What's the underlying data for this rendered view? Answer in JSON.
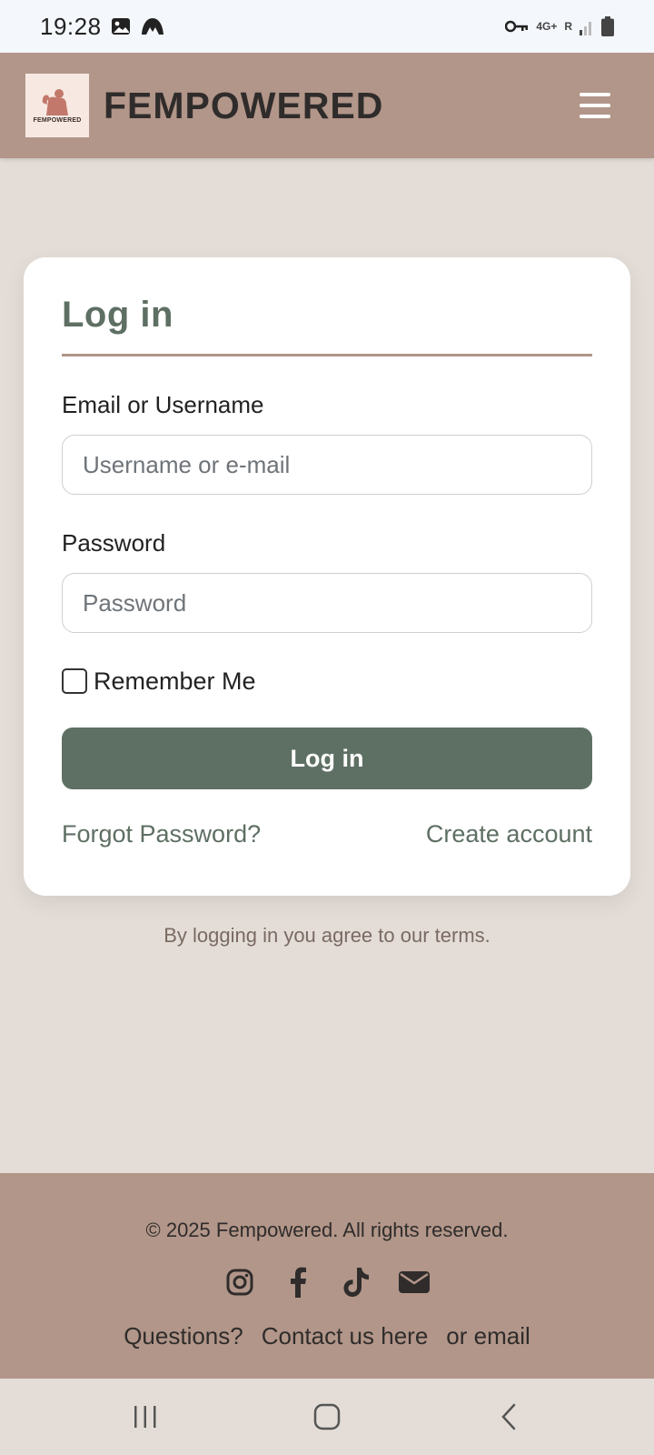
{
  "status_bar": {
    "time": "19:28",
    "network_label": "4G+",
    "roaming_label": "R",
    "icons": [
      "gallery-icon",
      "vpn-app-icon",
      "key-icon",
      "signal-icon",
      "battery-icon"
    ]
  },
  "header": {
    "logo_text": "FEMPOWERED",
    "brand": "FEMPOWERED",
    "menu_icon": "hamburger-icon"
  },
  "login": {
    "title": "Log in",
    "email_label": "Email or Username",
    "email_placeholder": "Username or e-mail",
    "email_value": "",
    "password_label": "Password",
    "password_placeholder": "Password",
    "password_value": "",
    "remember_label": "Remember Me",
    "remember_checked": false,
    "submit_label": "Log in",
    "forgot_label": "Forgot Password?",
    "create_label": "Create account"
  },
  "terms": "By logging in you agree to our terms.",
  "footer": {
    "copyright": "© 2025 Fempowered. All rights reserved.",
    "social_icons": [
      "instagram-icon",
      "facebook-icon",
      "tiktok-icon",
      "email-icon"
    ],
    "questions": "Questions?",
    "contact_link": "Contact us here",
    "or_email": "or email"
  },
  "colors": {
    "header_bg": "#b29689",
    "page_bg": "#e4ddd7",
    "accent_green": "#5e7063",
    "card_bg": "#ffffff"
  },
  "nav_bar": {
    "buttons": [
      "recent-apps-icon",
      "home-icon",
      "back-icon"
    ]
  }
}
